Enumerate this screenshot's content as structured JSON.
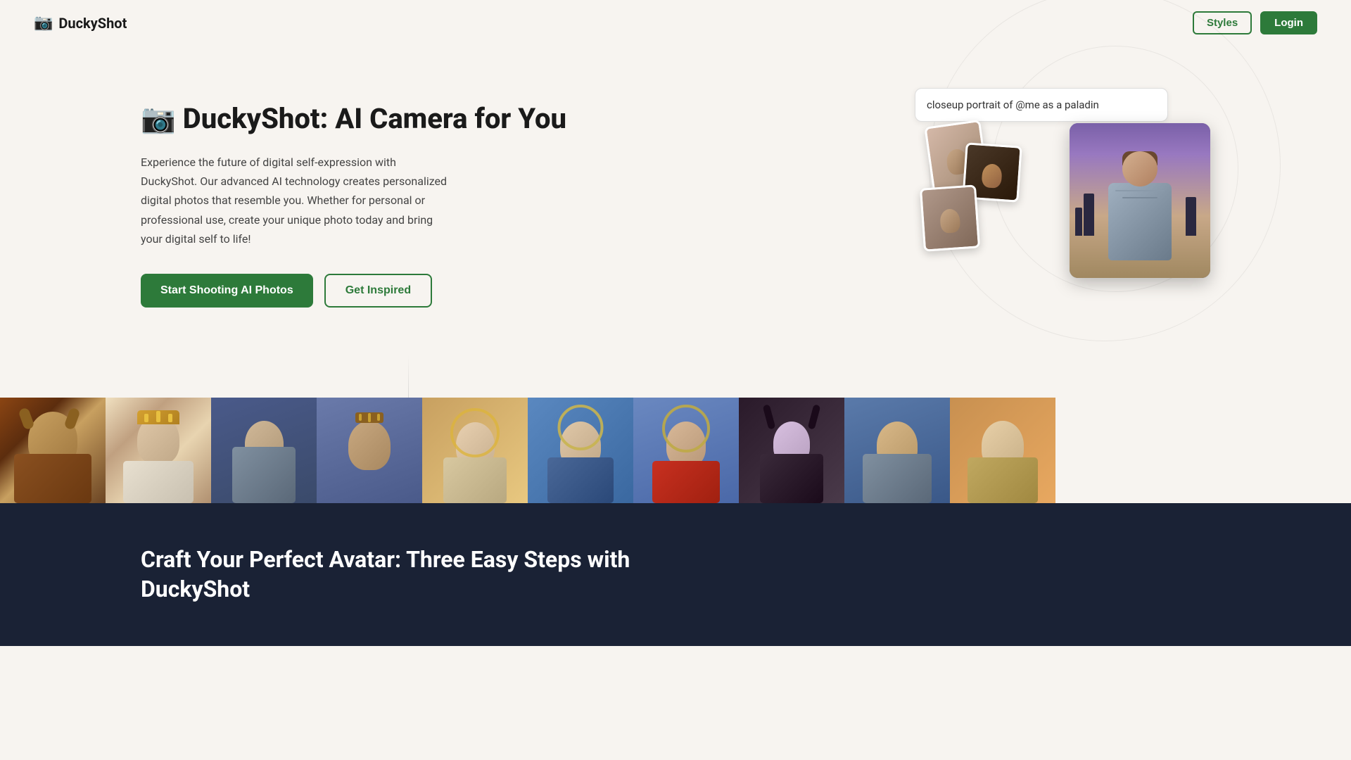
{
  "navbar": {
    "logo_icon": "📷",
    "logo_text": "DuckyShot",
    "styles_label": "Styles",
    "login_label": "Login"
  },
  "hero": {
    "title_icon": "📷",
    "title_brand": "DuckyShot",
    "title_suffix": ": AI Camera for You",
    "description": "Experience the future of digital self-expression with DuckyShot. Our advanced AI technology creates personalized digital photos that resemble you. Whether for personal or professional use, create your unique photo today and bring your digital self to life!",
    "cta_primary": "Start Shooting AI Photos",
    "cta_secondary": "Get Inspired",
    "demo_input_value": "closeup portrait of @me as a paladin"
  },
  "gallery": {
    "items": [
      {
        "id": 1,
        "alt": "Viking warrior portrait",
        "class": "gal-1"
      },
      {
        "id": 2,
        "alt": "Queen with crown portrait",
        "class": "gal-2"
      },
      {
        "id": 3,
        "alt": "Knight in armor portrait",
        "class": "gal-3"
      },
      {
        "id": 4,
        "alt": "Medieval king portrait",
        "class": "gal-4"
      },
      {
        "id": 5,
        "alt": "Religious portrait",
        "class": "gal-5"
      },
      {
        "id": 6,
        "alt": "Saint portrait",
        "class": "gal-6"
      },
      {
        "id": 7,
        "alt": "Modern saint portrait",
        "class": "gal-7"
      },
      {
        "id": 8,
        "alt": "Dark fantasy woman portrait",
        "class": "gal-8"
      },
      {
        "id": 9,
        "alt": "Fantasy warrior portrait",
        "class": "gal-9"
      },
      {
        "id": 10,
        "alt": "Royal portrait",
        "class": "gal-10"
      }
    ]
  },
  "bottom": {
    "title_line1": "Craft Your Perfect Avatar: Three Easy Steps with",
    "title_line2": "DuckyShot"
  }
}
